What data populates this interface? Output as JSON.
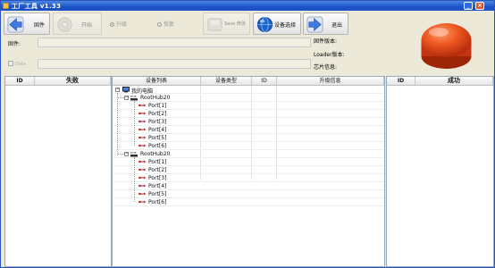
{
  "window": {
    "title": "工厂工具 v1.33"
  },
  "toolbar": {
    "firmware_label": "固件",
    "start_label": "开始",
    "upgrade_label": "升级",
    "restore_label": "恢复",
    "save_label": "Save 修改",
    "device_select_label": "设备选择",
    "exit_label": "退出"
  },
  "form": {
    "firmware_field_label": "固件:",
    "firmware_value": "",
    "date_label": "Date",
    "date_value": ""
  },
  "info": {
    "firmware_version": "固件版本:",
    "loader_version": "Loader版本:",
    "chip_info": "芯片信息:"
  },
  "fail_panel": {
    "col_id": "ID",
    "col_fail": "失败"
  },
  "ok_panel": {
    "col_id": "ID",
    "col_success": "成功"
  },
  "device_panel": {
    "columns": [
      "设备列表",
      "设备类型",
      "ID",
      "升级信息"
    ],
    "tree": {
      "root": "我的电脑",
      "hubs": [
        {
          "name": "RootHub20",
          "ports": [
            "Port[1]",
            "Port[2]",
            "Port[3]",
            "Port[4]",
            "Port[5]",
            "Port[6]"
          ]
        },
        {
          "name": "RootHub20",
          "ports": [
            "Port[1]",
            "Port[2]",
            "Port[3]",
            "Port[4]",
            "Port[5]",
            "Port[6]"
          ]
        }
      ]
    }
  },
  "colors": {
    "titlebar": "#1d55c9",
    "big_button": "#e8491f",
    "panel_border": "#9aa8bd"
  },
  "icons": {
    "firmware": "arrow-left-icon",
    "start": "disc-icon",
    "save": "save-icon",
    "device_select": "globe-icon",
    "exit": "arrow-right-icon",
    "port": "usb-icon",
    "hub": "hub-icon",
    "computer": "computer-icon"
  }
}
